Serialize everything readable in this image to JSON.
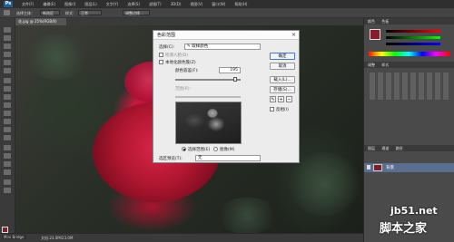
{
  "app": {
    "logo": "Ps"
  },
  "menu": [
    "文件(F)",
    "编辑(E)",
    "图像(I)",
    "图层(L)",
    "文字(Y)",
    "选择(S)",
    "滤镜(T)",
    "3D(D)",
    "视图(V)",
    "窗口(W)",
    "帮助(H)"
  ],
  "options": {
    "mode_label": "选择主体：",
    "mode_value": "新选区",
    "style_label": "样式：",
    "style_value": "正常",
    "refine_label": "调整边缘..."
  },
  "document": {
    "tab": "花.jpg @ 25%(RGB/8)",
    "zoom": "25%",
    "doc_size": "文档:23.0M/23.0M",
    "mini_bridge": "Mini Bridge"
  },
  "dialog": {
    "title": "色彩范围",
    "select_label": "选择(C):",
    "select_value": "取样颜色",
    "detect_faces": "检测人脸(D)",
    "localized": "本地化颜色簇(Z)",
    "fuzziness_label": "颜色容差(F):",
    "fuzziness_value": "195",
    "range_label": "范围(R):",
    "selection_radio": "选择范围(E)",
    "image_radio": "图像(M)",
    "preview_label": "选区预览(T):",
    "preview_value": "无",
    "ok": "确定",
    "cancel": "取消",
    "load": "载入(L)...",
    "save": "存储(S)...",
    "invert": "反相(I)",
    "eyedropper_icons": [
      "eyedropper-icon",
      "eyedropper-plus-icon",
      "eyedropper-minus-icon"
    ]
  },
  "panels": {
    "color_tab": "颜色",
    "swatches_tab": "色板",
    "adjustments_tab": "调整",
    "styles_tab": "样式",
    "layers_tab": "图层",
    "channels_tab": "通道",
    "paths_tab": "路径",
    "layer_name": "背景"
  },
  "watermark": {
    "site": "jb51.net",
    "name": "脚本之家"
  },
  "colors": {
    "foreground": "#8b1a2b",
    "background": "#ffffff",
    "accent": "#3a7bd5"
  }
}
